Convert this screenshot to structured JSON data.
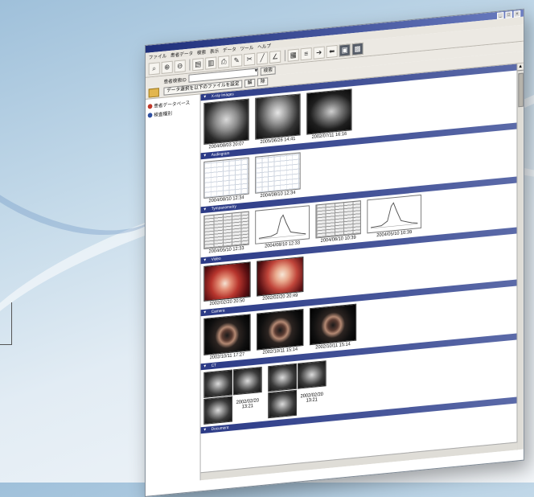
{
  "window": {
    "title_buttons": [
      "_",
      "□",
      "×"
    ]
  },
  "menu": [
    "ファイル",
    "患者データ",
    "検索",
    "表示",
    "データ",
    "ツール",
    "ヘルプ"
  ],
  "toolbar": {
    "right_labels": [
      "Next",
      "Prev",
      "Album",
      "Tile"
    ]
  },
  "search": {
    "label": "患者検索ID",
    "value": "",
    "button": "検索"
  },
  "filter": {
    "button1": "データ選択を以下のファイルを設定",
    "button2": "解",
    "button3": "除"
  },
  "tree": [
    {
      "label": "患者データベース",
      "icon": "database-icon"
    },
    {
      "label": "検査種別",
      "icon": "folder-icon"
    }
  ],
  "sections": [
    {
      "key": "xray",
      "title": "X-ray Images",
      "items": [
        {
          "caption": "2004/08/03 20:07"
        },
        {
          "caption": "2005/06/26 14:41"
        },
        {
          "caption": "2002/07/11 16:16"
        }
      ]
    },
    {
      "key": "audio",
      "title": "Audiogram",
      "items": [
        {
          "caption": "2004/08/10 12:34"
        },
        {
          "caption": "2004/08/10 12:34"
        }
      ]
    },
    {
      "key": "tympano",
      "title": "Tympanometry",
      "items": [
        {
          "caption": "2004/05/10 12:33"
        },
        {
          "caption": "2004/08/10 12:33"
        },
        {
          "caption": "2004/08/10 10:39"
        },
        {
          "caption": "2004/05/10 10:39"
        }
      ]
    },
    {
      "key": "endoscope",
      "title": "Video",
      "items": [
        {
          "caption": "2002/02/20 20:50"
        },
        {
          "caption": "2002/02/20 20:49"
        }
      ]
    },
    {
      "key": "ear",
      "title": "Camera",
      "items": [
        {
          "caption": "2002/10/11 17:27"
        },
        {
          "caption": "2002/10/11 15:14"
        },
        {
          "caption": "2002/10/11 15:14"
        }
      ]
    },
    {
      "key": "ct",
      "title": "CT",
      "items": [
        {
          "caption_line1": "2002/02/20",
          "caption_line2": "13:21"
        },
        {
          "caption_line1": "2002/02/20",
          "caption_line2": "13:21"
        }
      ]
    },
    {
      "key": "more",
      "title": "Document"
    }
  ],
  "colors": {
    "section_header": "#2b3a86",
    "title_bar": "#1f2f7a",
    "background": "#c6dbea"
  }
}
